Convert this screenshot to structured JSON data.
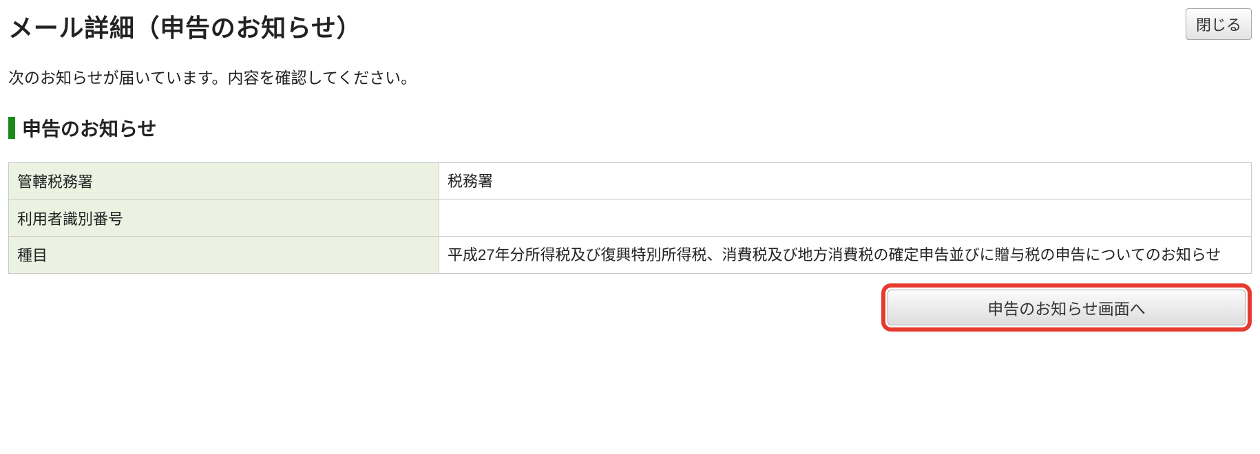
{
  "header": {
    "title": "メール詳細（申告のお知らせ）",
    "close_label": "閉じる"
  },
  "intro_text": "次のお知らせが届いています。内容を確認してください。",
  "section": {
    "title": "申告のお知らせ"
  },
  "table": {
    "rows": [
      {
        "label": "管轄税務署",
        "value": "税務署"
      },
      {
        "label": "利用者識別番号",
        "value": ""
      },
      {
        "label": "種目",
        "value": "平成27年分所得税及び復興特別所得税、消費税及び地方消費税の確定申告並びに贈与税の申告についてのお知らせ"
      }
    ]
  },
  "actions": {
    "notice_button_label": "申告のお知らせ画面へ"
  }
}
